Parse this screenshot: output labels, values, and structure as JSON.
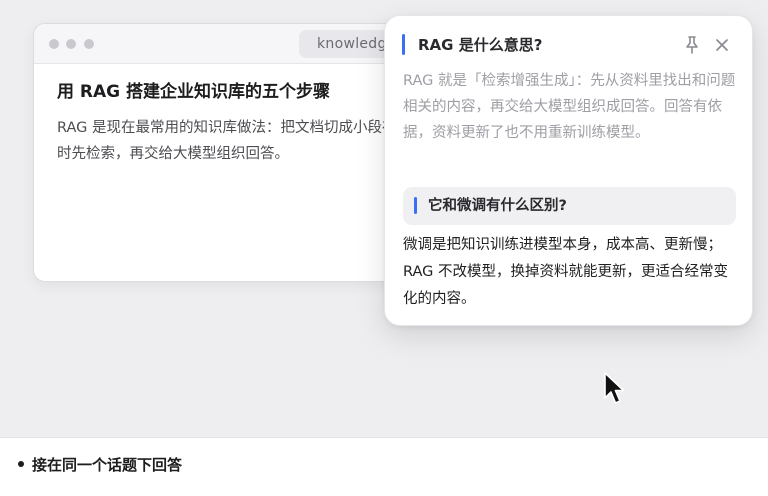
{
  "browser": {
    "url": "knowledge",
    "article_title": "用 RAG 搭建企业知识库的五个步骤",
    "article_body": "RAG 是现在最常用的知识库做法：把文档切成小段存起来，提问时先检索，再交给大模型组织回答。"
  },
  "popup": {
    "title": "RAG 是什么意思?",
    "first_answer": "RAG 就是「检索增强生成」：先从资料里找出和问题相关的内容，再交给大模型组织成回答。回答有依据，资料更新了也不用重新训练模型。",
    "follow_up_question": "它和微调有什么区别?",
    "follow_up_answer": "微调是把知识训练进模型本身，成本高、更新慢；RAG 不改模型，换掉资料就能更新，更适合经常变化的内容。",
    "pin_icon": "pin-icon",
    "close_icon": "close-icon"
  },
  "caption": {
    "text": "接在同一个话题下回答"
  },
  "colors": {
    "accent": "#3b6ff5",
    "stage_bg": "#eeeef0",
    "muted_text": "#9e9ea4"
  }
}
